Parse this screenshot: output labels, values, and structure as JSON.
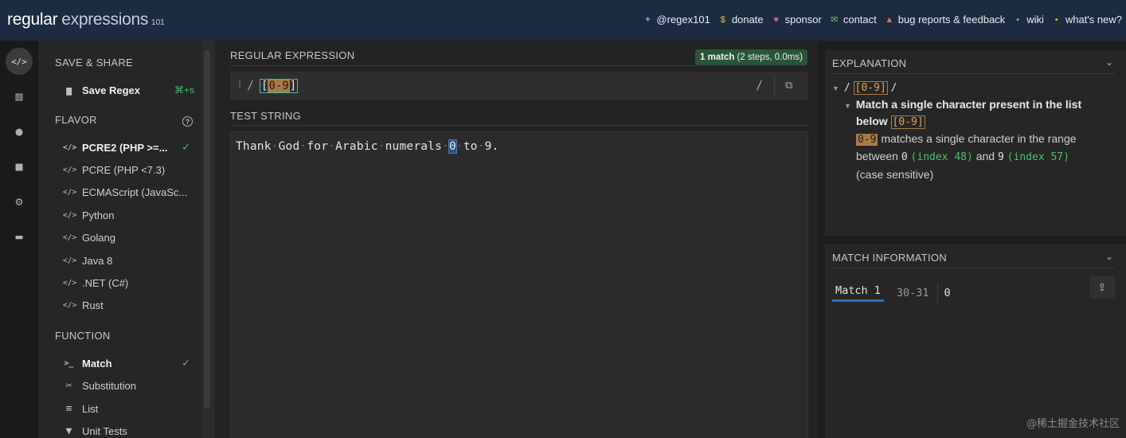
{
  "header": {
    "logo": {
      "word1": "regular",
      "word2": "expressions",
      "version": "101"
    },
    "links": [
      {
        "icon": "twitter-icon",
        "glyph": "✦",
        "label": "@regex101",
        "color": "#5ba3e0"
      },
      {
        "icon": "dollar-icon",
        "glyph": "$",
        "label": "donate",
        "color": "#e6c34a"
      },
      {
        "icon": "heart-icon",
        "glyph": "♥",
        "label": "sponsor",
        "color": "#e05ba8"
      },
      {
        "icon": "envelope-icon",
        "glyph": "✉",
        "label": "contact",
        "color": "#6fc56f"
      },
      {
        "icon": "warning-icon",
        "glyph": "▲",
        "label": "bug reports & feedback",
        "color": "#e0735b"
      },
      {
        "icon": "wiki-icon",
        "glyph": "▪",
        "label": "wiki",
        "color": "#5bb0e0"
      },
      {
        "icon": "news-icon",
        "glyph": "▪",
        "label": "what's new?",
        "color": "#e0b04a"
      }
    ]
  },
  "rail": {
    "items": [
      {
        "name": "rail-regex-editor",
        "icon": "code-icon",
        "glyph": "</>",
        "active": true
      },
      {
        "name": "rail-library",
        "icon": "library-icon",
        "glyph": "▥",
        "active": false
      },
      {
        "name": "rail-account",
        "icon": "user-icon",
        "glyph": "●",
        "active": false
      },
      {
        "name": "rail-quiz",
        "icon": "gamepad-icon",
        "glyph": "■",
        "active": false
      },
      {
        "name": "rail-settings",
        "icon": "gear-icon",
        "glyph": "⚙",
        "active": false
      },
      {
        "name": "rail-chat",
        "icon": "chat-icon",
        "glyph": "▬",
        "active": false
      }
    ]
  },
  "sidebar": {
    "save_title": "SAVE & SHARE",
    "save_label": "Save Regex",
    "save_shortcut": "⌘+s",
    "flavor_title": "FLAVOR",
    "flavors": [
      {
        "label": "PCRE2 (PHP >=...",
        "selected": true
      },
      {
        "label": "PCRE (PHP <7.3)",
        "selected": false
      },
      {
        "label": "ECMAScript (JavaSc...",
        "selected": false
      },
      {
        "label": "Python",
        "selected": false
      },
      {
        "label": "Golang",
        "selected": false
      },
      {
        "label": "Java 8",
        "selected": false
      },
      {
        "label": ".NET (C#)",
        "selected": false
      },
      {
        "label": "Rust",
        "selected": false
      }
    ],
    "function_title": "FUNCTION",
    "functions": [
      {
        "icon": "terminal-icon",
        "glyph": ">_",
        "label": "Match",
        "selected": true
      },
      {
        "icon": "scissors-icon",
        "glyph": "✂",
        "label": "Substitution",
        "selected": false
      },
      {
        "icon": "list-icon",
        "glyph": "≡",
        "label": "List",
        "selected": false
      },
      {
        "icon": "flask-icon",
        "glyph": "▼",
        "label": "Unit Tests",
        "selected": false
      }
    ]
  },
  "regex": {
    "title": "REGULAR EXPRESSION",
    "match_count": "1 match",
    "match_detail": "(2 steps, 0.0ms)",
    "delimiter_open": "/",
    "bracket_open": "[",
    "range": "0-9",
    "bracket_close": "]",
    "delimiter_close": "/"
  },
  "test": {
    "title": "TEST STRING",
    "words": [
      "Thank",
      "God",
      "for",
      "Arabic",
      "numerals"
    ],
    "match": "0",
    "after": [
      "to",
      "9."
    ]
  },
  "explanation": {
    "title": "EXPLANATION",
    "root_open": "/",
    "root_token": "[0-9]",
    "root_close": "/",
    "node_title_1": "Match a single character present in the list",
    "node_title_2": "below",
    "node_token": "[0-9]",
    "range_token": "0-9",
    "range_text": "matches a single character in the range",
    "between": "between",
    "char_start": "0",
    "index_start": "(index 48)",
    "and": "and",
    "char_end": "9",
    "index_end": "(index 57)",
    "case": "(case sensitive)"
  },
  "match_info": {
    "title": "MATCH INFORMATION",
    "match_label": "Match 1",
    "range": "30-31",
    "value": "0"
  },
  "watermark": "@稀土掘金技术社区"
}
